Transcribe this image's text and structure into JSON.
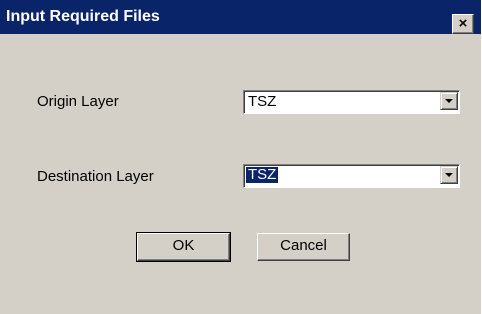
{
  "window": {
    "title": "Input Required Files",
    "close_glyph": "×"
  },
  "form": {
    "origin_label": "Origin Layer",
    "origin_value": "TSZ",
    "destination_label": "Destination Layer",
    "destination_value": "TSZ"
  },
  "buttons": {
    "ok": "OK",
    "cancel": "Cancel"
  },
  "colors": {
    "titlebar": "#0a246a",
    "face": "#d4d0c8",
    "highlight": "#0a246a"
  }
}
